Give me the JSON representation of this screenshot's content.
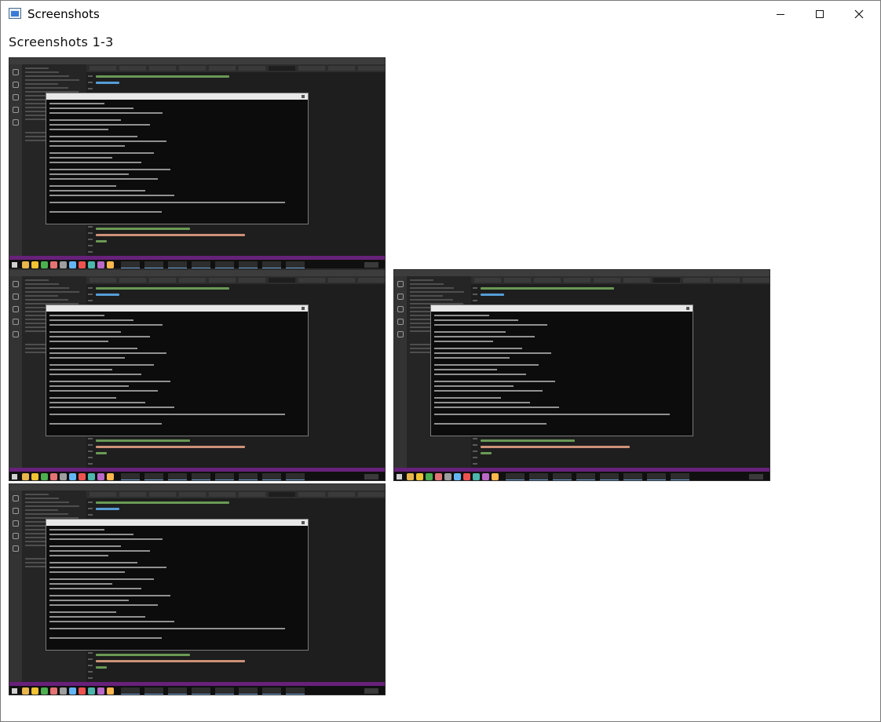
{
  "window": {
    "title": "Screenshots",
    "controls": {
      "minimize": "minimize",
      "maximize": "maximize",
      "close": "close"
    }
  },
  "heading": "Screenshots 1-3",
  "thumbnails": [
    {
      "id": "1"
    },
    {
      "id": "2"
    },
    {
      "id": "3"
    },
    {
      "id": "4"
    }
  ],
  "colors": {
    "editor_bg": "#1e1e1e",
    "statusbar": "#68217a",
    "terminal_bg": "#0c0c0c"
  }
}
